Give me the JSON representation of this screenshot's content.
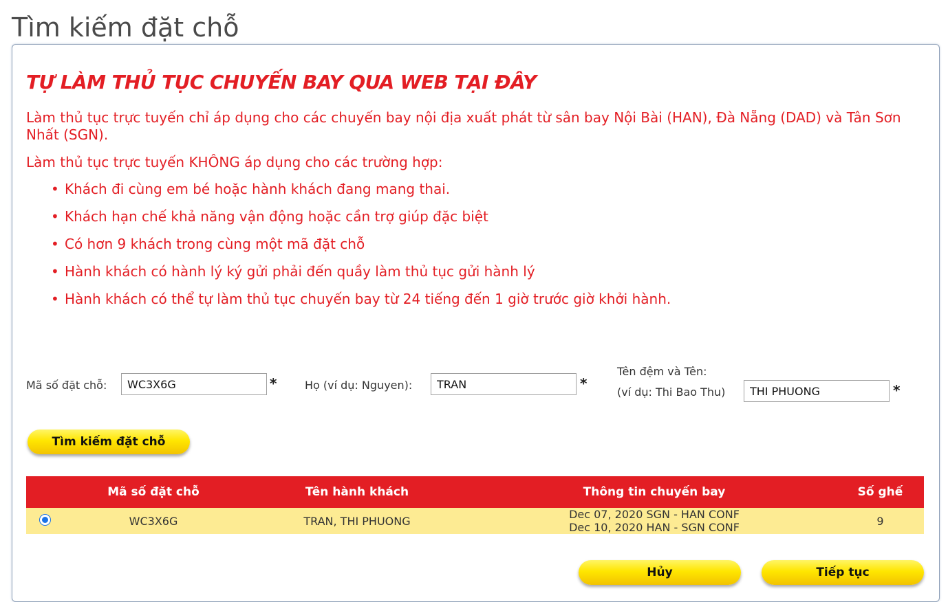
{
  "page": {
    "title": "Tìm kiếm đặt chỗ"
  },
  "notice": {
    "heading": "TỰ LÀM THỦ TỤC CHUYẾN BAY QUA WEB TẠI ĐÂY",
    "intro": "Làm thủ tục trực tuyến chỉ áp dụng cho các chuyến bay nội địa xuất phát từ sân bay Nội Bài (HAN), Đà Nẵng (DAD) và Tân Sơn Nhất (SGN).",
    "not_applicable": "Làm thủ tục trực tuyến KHÔNG áp dụng cho các trường hợp:",
    "rules": [
      "Khách đi cùng em bé hoặc hành khách đang mang thai.",
      "Khách hạn chế khả năng vận động hoặc cần trợ giúp đặc biệt",
      "Có hơn 9 khách trong cùng một mã đặt chỗ",
      "Hành khách có hành lý ký gửi phải đến quầy làm thủ tục gửi hành lý",
      "Hành khách có thể tự làm thủ tục chuyến bay từ 24 tiếng đến 1 giờ trước giờ khởi hành."
    ],
    "bullet": "•"
  },
  "form": {
    "booking_code": {
      "label": "Mã số đặt chỗ:",
      "value": "WC3X6G"
    },
    "last_name": {
      "label": "Họ (ví dụ: Nguyen):",
      "value": "TRAN"
    },
    "first_name": {
      "label_line1": "Tên đệm và Tên:",
      "label_line2": "(ví dụ: Thi Bao Thu)",
      "value": "THI PHUONG"
    },
    "required_mark": "*",
    "search_button": "Tìm kiếm đặt chỗ"
  },
  "results": {
    "headers": [
      "Mã số đặt chỗ",
      "Tên hành khách",
      "Thông tin chuyến bay",
      "Số ghế"
    ],
    "rows": [
      {
        "selected": true,
        "code": "WC3X6G",
        "passenger": "TRAN, THI PHUONG",
        "flight_line1": "Dec 07, 2020 SGN - HAN CONF",
        "flight_line2": "Dec 10, 2020 HAN - SGN CONF",
        "seats": "9"
      }
    ]
  },
  "actions": {
    "cancel": "Hủy",
    "continue": "Tiếp tục"
  },
  "colors": {
    "brand_red": "#e31e24",
    "button_yellow": "#ffe600",
    "row_highlight": "#fdeb93",
    "radio_blue": "#1a73e8"
  }
}
